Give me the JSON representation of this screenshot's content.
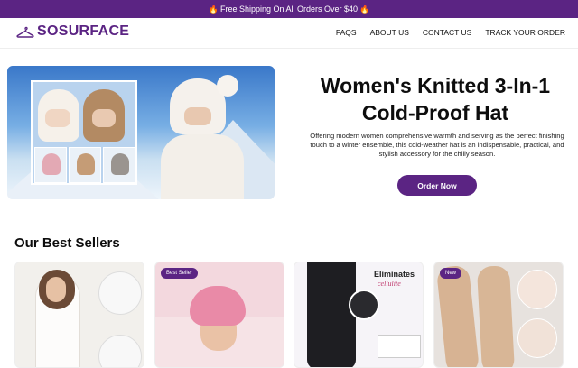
{
  "announcement": {
    "icon_left": "fire-icon",
    "text": "Free Shipping On All Orders Over $40",
    "icon_right": "fire-icon",
    "bg_color": "#5b2483"
  },
  "header": {
    "logo_icon": "hanger-icon",
    "logo_text": "SOSURFACE",
    "nav": [
      "FAQS",
      "ABOUT US",
      "CONTACT US",
      "TRACK YOUR ORDER"
    ]
  },
  "hero": {
    "title": "Women's Knitted 3-In-1 Cold-Proof Hat",
    "description": "Offering modern women comprehensive warmth and serving as the perfect finishing touch to a winter ensemble, this cold-weather hat is an indispensable, practical, and stylish accessory for the chilly season.",
    "button_label": "Order Now"
  },
  "best_sellers": {
    "title": "Our Best Sellers",
    "cards": [
      {
        "badge": ""
      },
      {
        "badge": "Best Seller"
      },
      {
        "badge": "",
        "image_text_1": "Eliminates",
        "image_text_2": "cellulite"
      },
      {
        "badge": "New"
      }
    ]
  },
  "colors": {
    "accent": "#5b2483"
  }
}
